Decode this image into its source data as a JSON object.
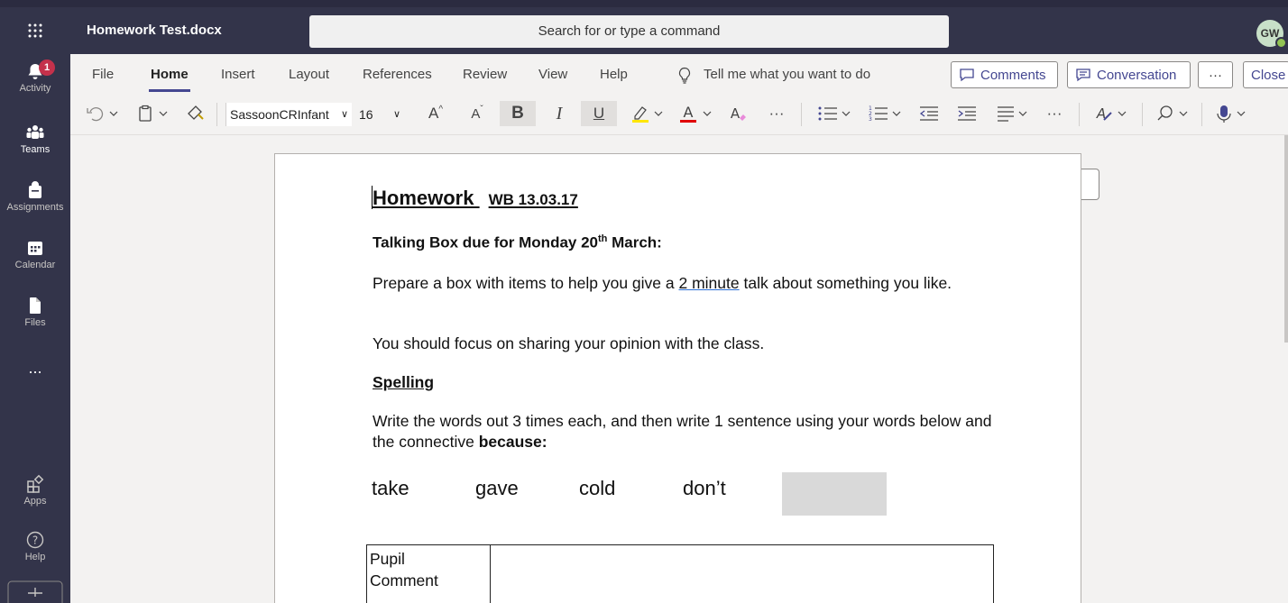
{
  "app": {
    "document_title": "Homework Test.docx",
    "search_placeholder": "Search for or type a command",
    "user_initials": "GW"
  },
  "rail": {
    "items": [
      {
        "label": "Activity",
        "badge": "1"
      },
      {
        "label": "Teams"
      },
      {
        "label": "Assignments"
      },
      {
        "label": "Calendar"
      },
      {
        "label": "Files"
      },
      {
        "label": "..."
      },
      {
        "label": "Apps"
      },
      {
        "label": "Help"
      }
    ]
  },
  "ribbon": {
    "tabs": [
      "File",
      "Home",
      "Insert",
      "Layout",
      "References",
      "Review",
      "View",
      "Help"
    ],
    "tell_me": "Tell me what you want to do",
    "comments_label": "Comments",
    "conversation_label": "Conversation",
    "more_label": "···",
    "close_label": "Close",
    "font_name": "SassoonCRInfant",
    "font_size": "16",
    "bold": "B",
    "italic": "I",
    "underline": "U",
    "grow_font": "A",
    "shrink_font": "A",
    "ellipsis": "···"
  },
  "document": {
    "heading_main": "Homework",
    "heading_wb": "WB 13.03.17",
    "talking_box_pre": "Talking Box due for Monday 20",
    "talking_box_sup": "th",
    "talking_box_post": " March:",
    "prepare_pre": "Prepare a box with items to help you give a ",
    "prepare_link": "2 minute",
    "prepare_post": " talk about something you like.",
    "focus": "You should focus on sharing your opinion with the class.",
    "spelling_heading": "Spelling",
    "write_pre": "Write the words out 3 times each, and then write 1 sentence using your words below and the connective ",
    "write_bold": "because:",
    "words": [
      "take",
      "gave",
      "cold",
      "don’t"
    ],
    "table_label_1": "Pupil",
    "table_label_2": "Comment"
  },
  "colors": {
    "rail_bg": "#33344a",
    "accent": "#444791",
    "badge": "#c4314b",
    "presence": "#92c353"
  }
}
